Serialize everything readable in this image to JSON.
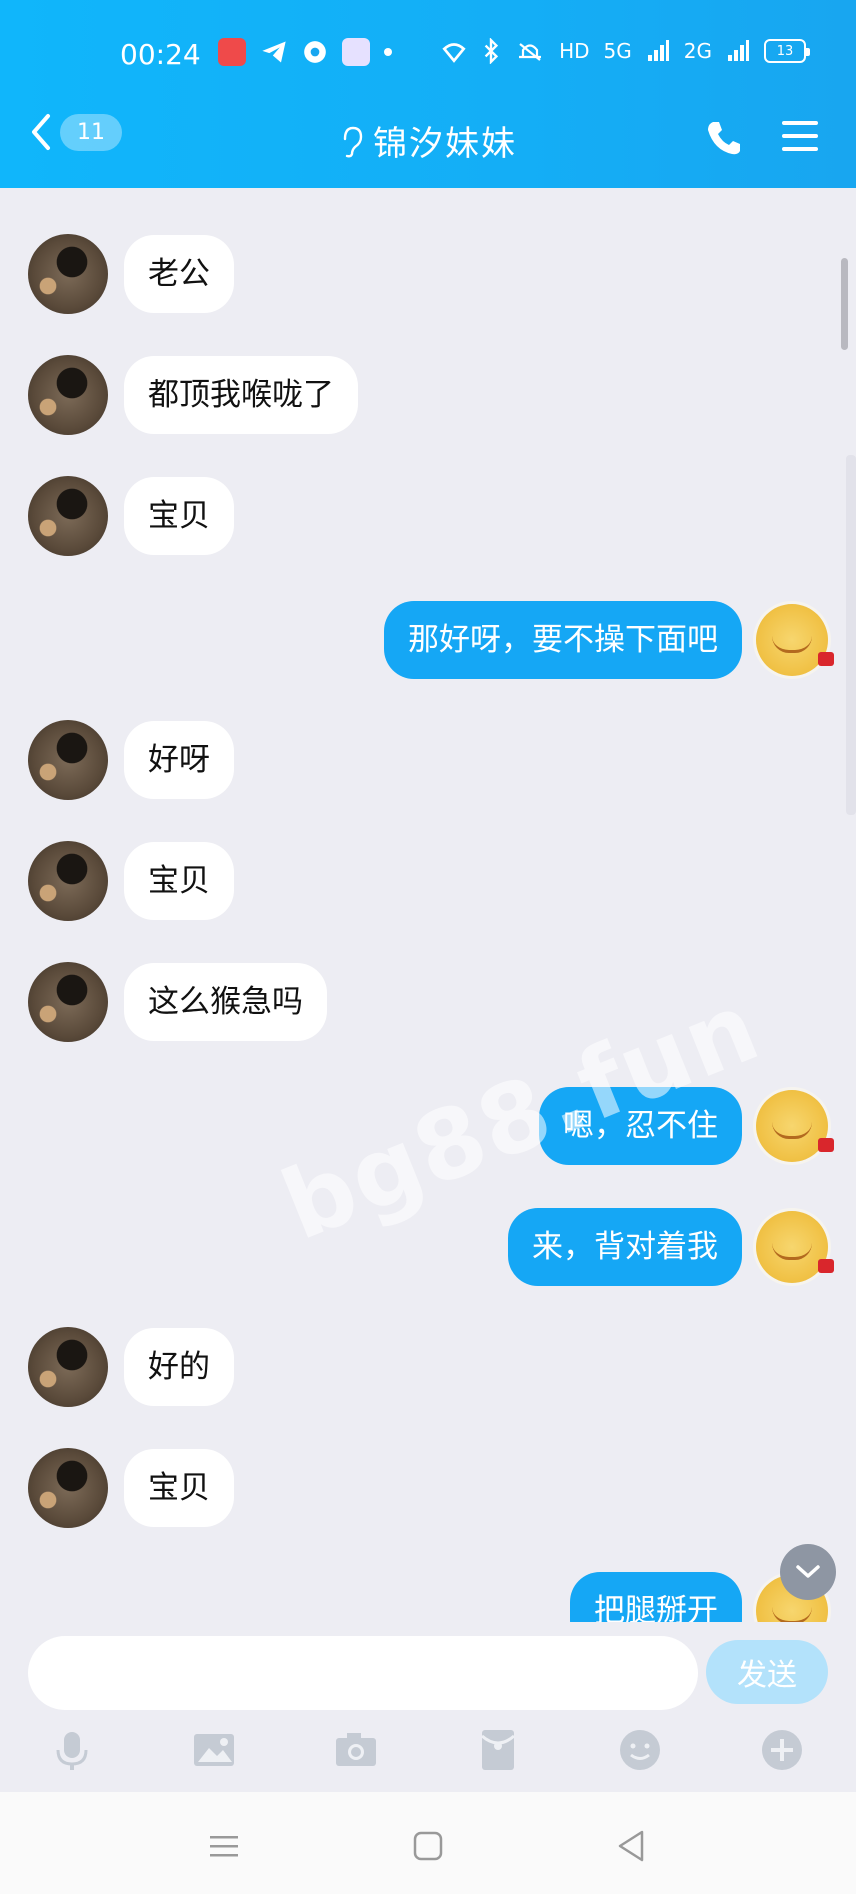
{
  "status_bar": {
    "time": "00:24",
    "network": "HD",
    "signal_1": "5G",
    "signal_2": "2G",
    "battery": "13"
  },
  "header": {
    "back_count": "11",
    "title": "锦汐妹妹"
  },
  "messages": [
    {
      "side": "left",
      "text": "老公"
    },
    {
      "side": "left",
      "text": "都顶我喉咙了"
    },
    {
      "side": "left",
      "text": "宝贝"
    },
    {
      "side": "right",
      "text": "那好呀，要不操下面吧"
    },
    {
      "side": "left",
      "text": "好呀"
    },
    {
      "side": "left",
      "text": "宝贝"
    },
    {
      "side": "left",
      "text": "这么猴急吗"
    },
    {
      "side": "right",
      "text": "嗯，忍不住"
    },
    {
      "side": "right",
      "text": "来，背对着我"
    },
    {
      "side": "left",
      "text": "好的"
    },
    {
      "side": "left",
      "text": "宝贝"
    },
    {
      "side": "right",
      "text": "把腿掰开"
    }
  ],
  "watermark": "bg88.fun",
  "composer": {
    "input_value": "",
    "send_label": "发送"
  },
  "colors": {
    "header": "#12b0f7",
    "my_bubble": "#15a7f5",
    "background": "#ededf3"
  }
}
